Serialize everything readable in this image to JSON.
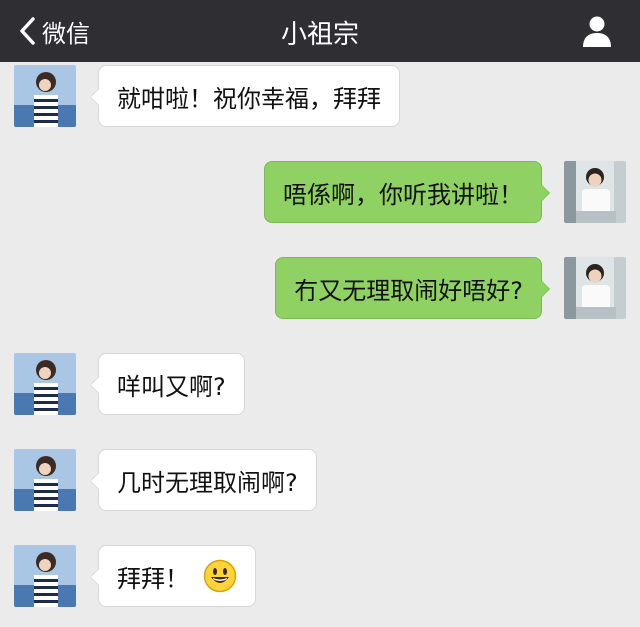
{
  "header": {
    "back_label": "微信",
    "title": "小祖宗",
    "back_icon": "chevron-left-icon",
    "profile_icon": "person-icon"
  },
  "messages": [
    {
      "side": "left",
      "text": "就咁啦！祝你幸福，拜拜"
    },
    {
      "side": "right",
      "text": "唔係啊，你听我讲啦！"
    },
    {
      "side": "right",
      "text": "冇又无理取闹好唔好?"
    },
    {
      "side": "left",
      "text": "咩叫又啊?"
    },
    {
      "side": "left",
      "text": "几时无理取闹啊?"
    },
    {
      "side": "left",
      "text": "拜拜！",
      "emoji": "smiley-emoji-icon"
    }
  ],
  "colors": {
    "nav_bg": "#2e2e33",
    "chat_bg": "#ebebeb",
    "sent_bubble": "#8fd162",
    "received_bubble": "#ffffff"
  }
}
